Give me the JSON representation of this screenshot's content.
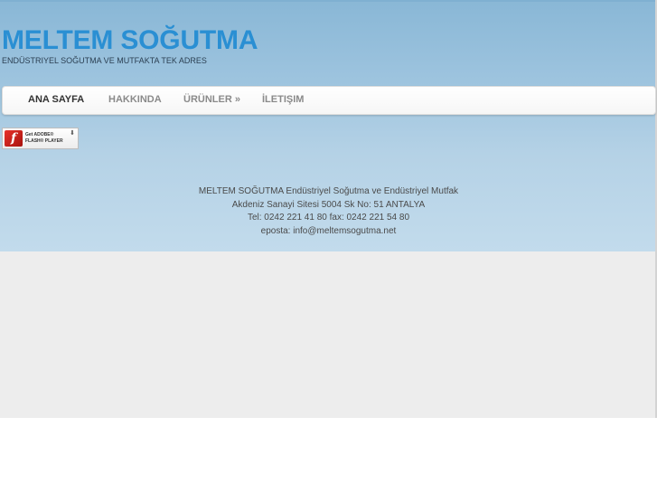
{
  "header": {
    "site_title": "MELTEM SOĞUTMA",
    "tagline": "ENDÜSTRIYEL SOĞUTMA VE MUTFAKTA TEK ADRES"
  },
  "nav": {
    "items": [
      {
        "label": "ANA SAYFA",
        "active": true
      },
      {
        "label": "HAKKINDA",
        "active": false
      },
      {
        "label": "ÜRÜNLER »",
        "active": false
      },
      {
        "label": "İLETIŞIM",
        "active": false
      }
    ]
  },
  "flash_badge": {
    "line1": "Get ADOBE®",
    "line2": "FLASH® PLAYER",
    "icon": "flash-player-icon"
  },
  "footer": {
    "line1": "MELTEM SOĞUTMA Endüstriyel Soğutma ve Endüstriyel Mutfak",
    "line2": "Akdeniz Sanayi Sitesi 5004 Sk No: 51 ANTALYA",
    "line3": "Tel: 0242 221 41 80 fax: 0242 221 54 80",
    "line4": "eposta: info@meltemsogutma.net"
  },
  "colors": {
    "title": "#2a8fd3",
    "hero_top": "#89b7d6",
    "hero_bottom": "#c2dbec",
    "page_bg": "#ededed",
    "nav_active": "#333333",
    "nav_inactive": "#8a8a8a"
  }
}
